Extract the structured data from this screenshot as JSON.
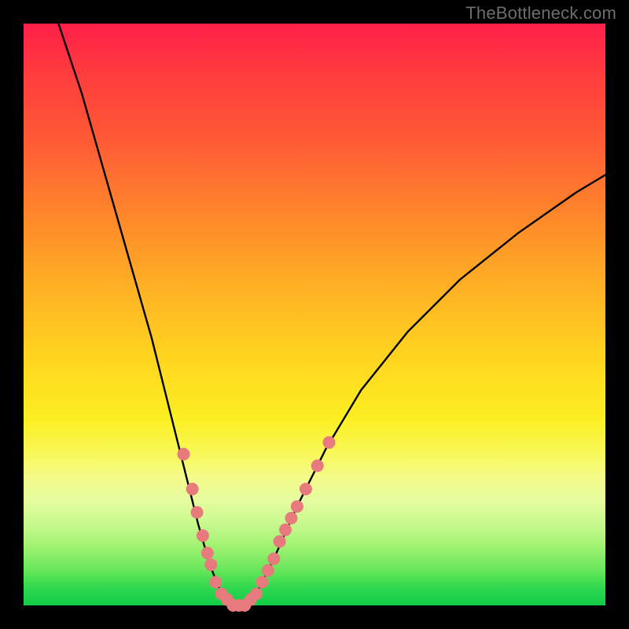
{
  "watermark": "TheBottleneck.com",
  "chart_data": {
    "type": "line",
    "title": "",
    "xlabel": "",
    "ylabel": "",
    "xlim": [
      0,
      100
    ],
    "ylim": [
      0,
      100
    ],
    "grid": false,
    "legend": false,
    "series": [
      {
        "name": "bottleneck-curve",
        "stroke": "#000000",
        "points": [
          {
            "x": 6,
            "y": 100
          },
          {
            "x": 10,
            "y": 88
          },
          {
            "x": 14,
            "y": 74
          },
          {
            "x": 18,
            "y": 60
          },
          {
            "x": 22,
            "y": 46
          },
          {
            "x": 25,
            "y": 34
          },
          {
            "x": 28,
            "y": 22
          },
          {
            "x": 30,
            "y": 14
          },
          {
            "x": 32,
            "y": 7
          },
          {
            "x": 34,
            "y": 2
          },
          {
            "x": 36,
            "y": 0
          },
          {
            "x": 38,
            "y": 0
          },
          {
            "x": 40,
            "y": 2
          },
          {
            "x": 43,
            "y": 8
          },
          {
            "x": 47,
            "y": 17
          },
          {
            "x": 52,
            "y": 27
          },
          {
            "x": 58,
            "y": 37
          },
          {
            "x": 66,
            "y": 47
          },
          {
            "x": 75,
            "y": 56
          },
          {
            "x": 85,
            "y": 64
          },
          {
            "x": 95,
            "y": 71
          },
          {
            "x": 100,
            "y": 74
          }
        ]
      },
      {
        "name": "marker-dots",
        "stroke": "#e77a7c",
        "fill": "#e77a7c",
        "points": [
          {
            "x": 27.5,
            "y": 26
          },
          {
            "x": 29.0,
            "y": 20
          },
          {
            "x": 29.8,
            "y": 16
          },
          {
            "x": 30.8,
            "y": 12
          },
          {
            "x": 31.6,
            "y": 9
          },
          {
            "x": 32.2,
            "y": 7
          },
          {
            "x": 33.0,
            "y": 4
          },
          {
            "x": 34.0,
            "y": 2
          },
          {
            "x": 35.0,
            "y": 1
          },
          {
            "x": 36.0,
            "y": 0
          },
          {
            "x": 37.0,
            "y": 0
          },
          {
            "x": 38.0,
            "y": 0
          },
          {
            "x": 39.0,
            "y": 1
          },
          {
            "x": 40.0,
            "y": 2
          },
          {
            "x": 41.0,
            "y": 4
          },
          {
            "x": 42.0,
            "y": 6
          },
          {
            "x": 43.0,
            "y": 8
          },
          {
            "x": 44.0,
            "y": 11
          },
          {
            "x": 45.0,
            "y": 13
          },
          {
            "x": 46.0,
            "y": 15
          },
          {
            "x": 47.0,
            "y": 17
          },
          {
            "x": 48.5,
            "y": 20
          },
          {
            "x": 50.5,
            "y": 24
          },
          {
            "x": 52.5,
            "y": 28
          }
        ]
      }
    ]
  }
}
